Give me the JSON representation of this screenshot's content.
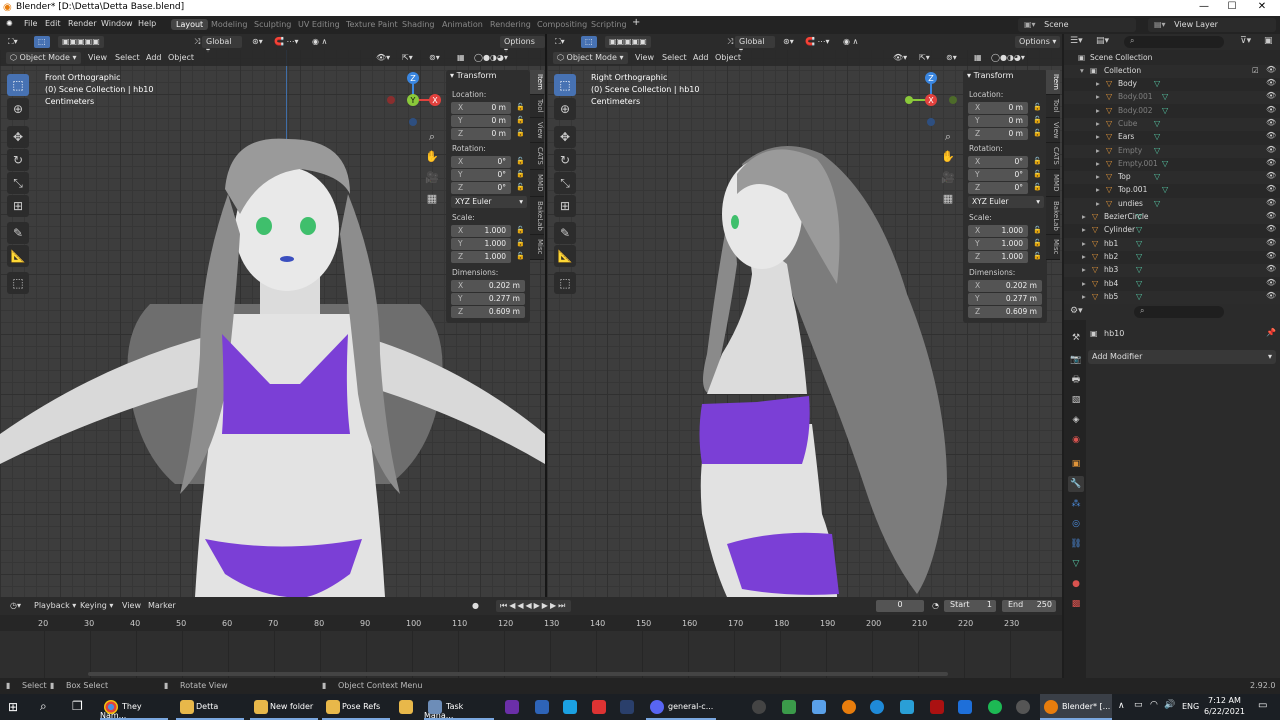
{
  "window": {
    "title": "Blender* [D:\\Detta\\Detta Base.blend]"
  },
  "menus": [
    "File",
    "Edit",
    "Render",
    "Window",
    "Help"
  ],
  "workspaces": [
    "Layout",
    "Modeling",
    "Sculpting",
    "UV Editing",
    "Texture Paint",
    "Shading",
    "Animation",
    "Rendering",
    "Compositing",
    "Scripting"
  ],
  "active_workspace": "Layout",
  "scene": "Scene",
  "view_layer": "View Layer",
  "header": {
    "orientation": "Global",
    "options": "Options",
    "mode": "Object Mode",
    "view": "View",
    "select": "Select",
    "add": "Add",
    "object": "Object"
  },
  "viewport_left": {
    "view_name": "Front Orthographic",
    "collection": "(0) Scene Collection | hb10",
    "units": "Centimeters"
  },
  "viewport_right": {
    "view_name": "Right Orthographic",
    "collection": "(0) Scene Collection | hb10",
    "units": "Centimeters"
  },
  "transform": {
    "title": "Transform",
    "location_label": "Location:",
    "location": [
      "0 m",
      "0 m",
      "0 m"
    ],
    "rotation_label": "Rotation:",
    "rotation": [
      "0°",
      "0°",
      "0°"
    ],
    "rotation_mode": "XYZ Euler",
    "scale_label": "Scale:",
    "scale": [
      "1.000",
      "1.000",
      "1.000"
    ],
    "dimensions_label": "Dimensions:",
    "dimensions": [
      "0.202 m",
      "0.277 m",
      "0.609 m"
    ],
    "axes": [
      "X",
      "Y",
      "Z"
    ]
  },
  "npanel_tabs": [
    "Item",
    "Tool",
    "View",
    "CATS",
    "MMD",
    "BakeLab",
    "Misc"
  ],
  "gizmo_axes": {
    "x": "X",
    "y": "Y",
    "z": "Z"
  },
  "outliner": {
    "scene_collection": "Scene Collection",
    "collection": "Collection",
    "items": [
      {
        "name": "Body",
        "dim": false
      },
      {
        "name": "Body.001",
        "dim": true
      },
      {
        "name": "Body.002",
        "dim": true
      },
      {
        "name": "Cube",
        "dim": true
      },
      {
        "name": "Ears",
        "dim": false
      },
      {
        "name": "Empty",
        "dim": true
      },
      {
        "name": "Empty.001",
        "dim": true
      },
      {
        "name": "Top",
        "dim": false
      },
      {
        "name": "Top.001",
        "dim": false
      },
      {
        "name": "undies",
        "dim": false
      }
    ],
    "root_items": [
      "BezierCircle",
      "Cylinder",
      "hb1",
      "hb2",
      "hb3",
      "hb4",
      "hb5"
    ]
  },
  "properties": {
    "object": "hb10",
    "add_modifier": "Add Modifier"
  },
  "timeline": {
    "menus": [
      "Playback",
      "Keying",
      "View",
      "Marker"
    ],
    "current_frame": "0",
    "start_label": "Start",
    "start": "1",
    "end_label": "End",
    "end": "250",
    "ticks": [
      "20",
      "30",
      "40",
      "50",
      "60",
      "70",
      "80",
      "90",
      "100",
      "110",
      "120",
      "130",
      "140",
      "150",
      "160",
      "170",
      "180",
      "190",
      "200",
      "210",
      "220",
      "230"
    ]
  },
  "statusbar": {
    "select": "Select",
    "box_select": "Box Select",
    "rotate_view": "Rotate View",
    "context_menu": "Object Context Menu",
    "version": "2.92.0"
  },
  "taskbar": {
    "apps": [
      "They Nam...",
      "Detta",
      "New folder",
      "Pose Refs",
      "Task Mana...",
      "general-c...",
      "Blender* [..."
    ],
    "lang": "ENG",
    "time": "7:12 AM",
    "date": "6/22/2021"
  },
  "colors": {
    "accent": "#4772b3",
    "undies": "#7b3fd6",
    "x_axis": "#e2413d",
    "y_axis": "#8ac93a",
    "z_axis": "#3a86e0"
  }
}
